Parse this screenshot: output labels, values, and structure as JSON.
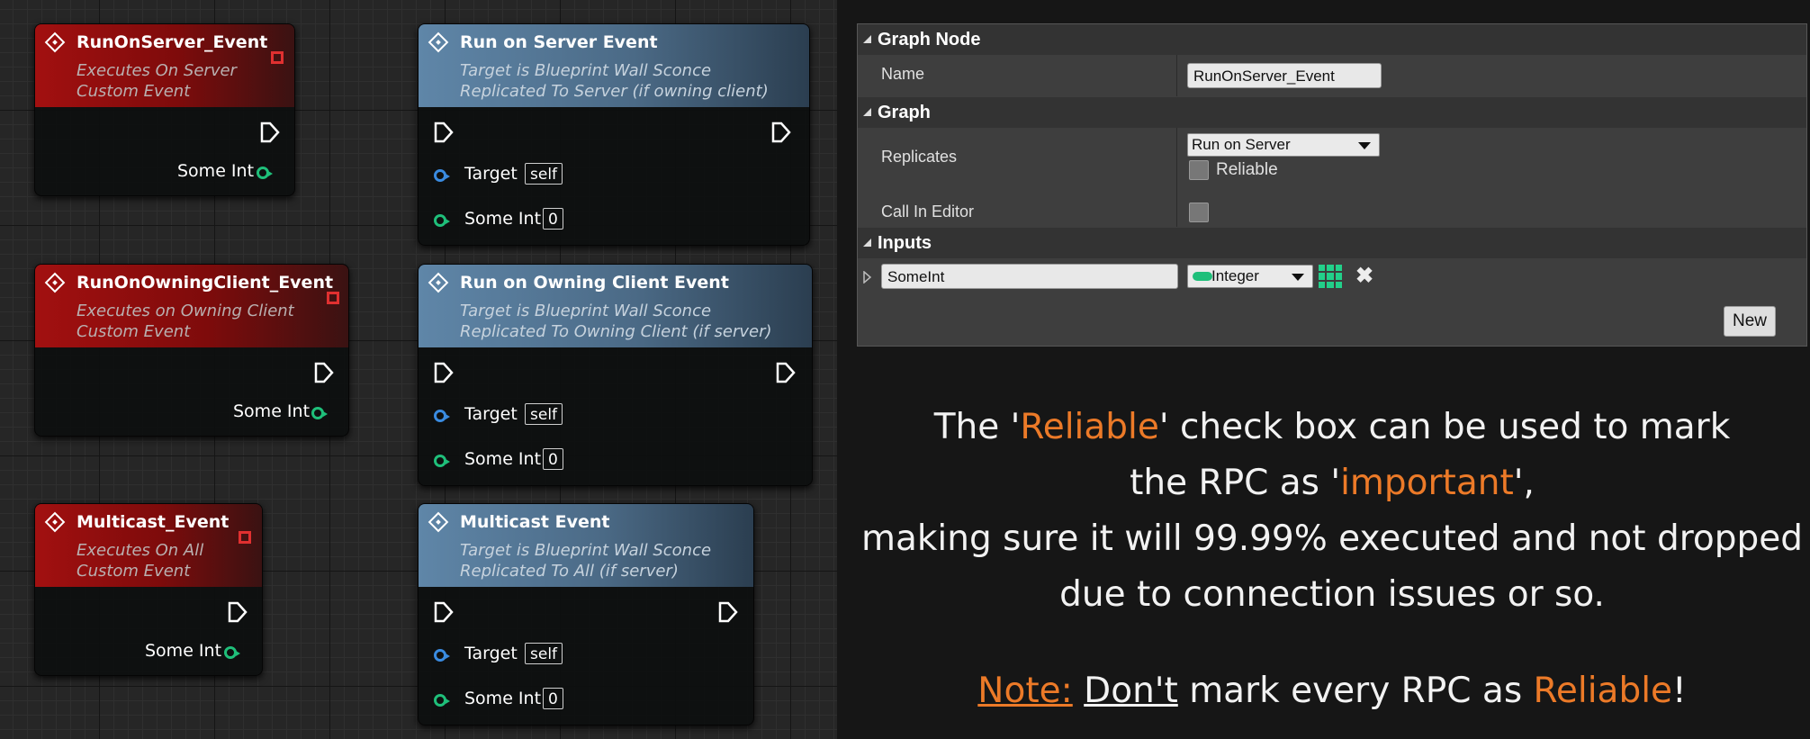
{
  "colors": {
    "accent": "#ec7a28",
    "event_red": "#a21010",
    "function_blue": "#5f86a8",
    "int_pin": "#1fbf7a",
    "object_pin": "#3a8be0"
  },
  "events": [
    {
      "title": "RunOnServer_Event",
      "sub1": "Executes On Server",
      "sub2": "Custom Event",
      "pin_label": "Some Int"
    },
    {
      "title": "RunOnOwningClient_Event",
      "sub1": "Executes on Owning Client",
      "sub2": "Custom Event",
      "pin_label": "Some Int"
    },
    {
      "title": "Multicast_Event",
      "sub1": "Executes On All",
      "sub2": "Custom Event",
      "pin_label": "Some Int"
    }
  ],
  "calls": [
    {
      "title": "Run on Server Event",
      "sub1": "Target is Blueprint Wall Sconce",
      "sub2": "Replicated To Server (if owning client)",
      "target_label": "Target",
      "target_value": "self",
      "int_label": "Some Int",
      "int_value": "0"
    },
    {
      "title": "Run on Owning Client Event",
      "sub1": "Target is Blueprint Wall Sconce",
      "sub2": "Replicated To Owning Client (if server)",
      "target_label": "Target",
      "target_value": "self",
      "int_label": "Some Int",
      "int_value": "0"
    },
    {
      "title": "Multicast Event",
      "sub1": "Target is Blueprint Wall Sconce",
      "sub2": "Replicated To All (if server)",
      "target_label": "Target",
      "target_value": "self",
      "int_label": "Some Int",
      "int_value": "0"
    }
  ],
  "details": {
    "graph_node_header": "Graph Node",
    "name_label": "Name",
    "name_value": "RunOnServer_Event",
    "graph_header": "Graph",
    "replicates_label": "Replicates",
    "replicates_value": "Run on Server",
    "reliable_label": "Reliable",
    "reliable_checked": false,
    "call_in_editor_label": "Call In Editor",
    "call_in_editor_checked": false,
    "inputs_header": "Inputs",
    "input_name": "SomeInt",
    "input_type": "Integer",
    "new_button": "New"
  },
  "explanation": {
    "l1_a": "The '",
    "l1_b": "Reliable",
    "l1_c": "' check box can be used to mark",
    "l2_a": "the RPC as '",
    "l2_b": "important",
    "l2_c": "',",
    "l3": "making sure it will  99.99% executed and not dropped",
    "l4": "due to connection issues or so.",
    "note_label": "Note:",
    "note_dont": "Don't",
    "note_mid": " mark every RPC as ",
    "note_reliable": "Reliable",
    "note_end": "!"
  }
}
